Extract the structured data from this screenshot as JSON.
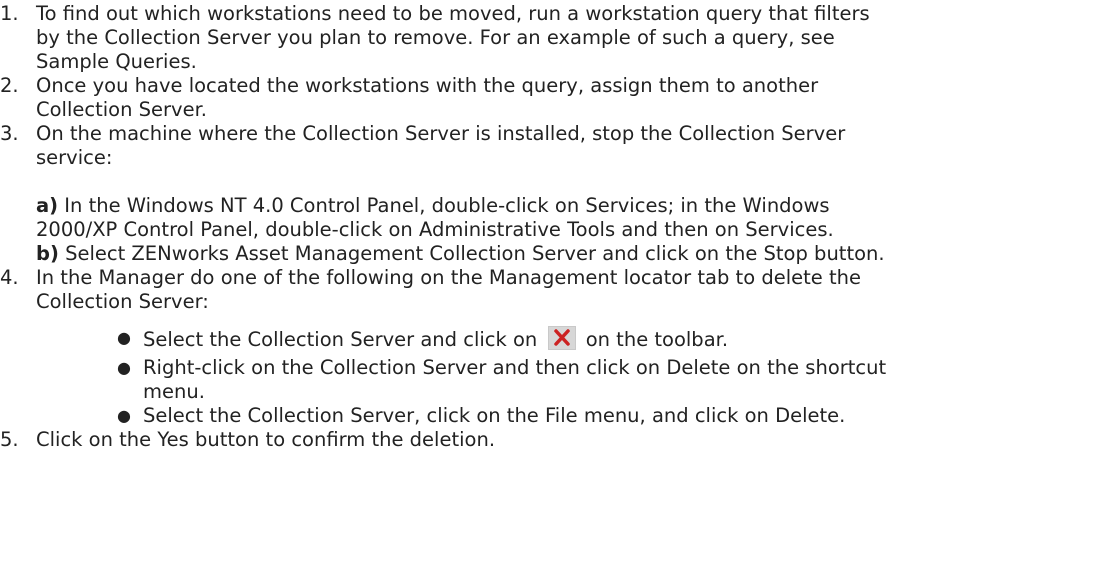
{
  "steps": [
    {
      "number": "1.",
      "lines": [
        "To find out which workstations need to be moved, run a workstation query that filters",
        "by the Collection Server you plan to remove. For an example of such a query, see",
        "Sample Queries."
      ]
    },
    {
      "number": "2.",
      "lines": [
        "Once you have located the workstations with the query, assign them to another",
        "Collection Server."
      ]
    },
    {
      "number": "3.",
      "lines": [
        "On the machine where the Collection Server is installed, stop the Collection Server",
        "service:"
      ],
      "substeps": [
        {
          "label": "a)",
          "lines": [
            " In the Windows NT 4.0 Control Panel, double-click on Services; in the Windows",
            "2000/XP Control Panel, double-click on Administrative Tools and then on Services."
          ]
        },
        {
          "label": "b)",
          "lines": [
            " Select ZENworks Asset Management Collection Server and click on the Stop button."
          ]
        }
      ]
    },
    {
      "number": "4.",
      "lines": [
        "In the Manager do one of the following on the Management locator tab to delete the",
        "Collection Server:"
      ],
      "bullets": [
        {
          "before_icon": "Select the Collection Server and click on",
          "icon": "delete-x-icon",
          "after_icon": "on the toolbar."
        },
        {
          "lines": [
            "Right-click on the Collection Server and then click on Delete on the shortcut",
            "menu."
          ]
        },
        {
          "lines": [
            "Select the Collection Server, click on the File menu, and click on Delete."
          ]
        }
      ]
    },
    {
      "number": "5.",
      "lines": [
        "Click on the Yes button to confirm the deletion."
      ]
    }
  ],
  "colors": {
    "text": "#222222",
    "icon_x": "#cc2222",
    "icon_bg": "#d7d7d7"
  }
}
